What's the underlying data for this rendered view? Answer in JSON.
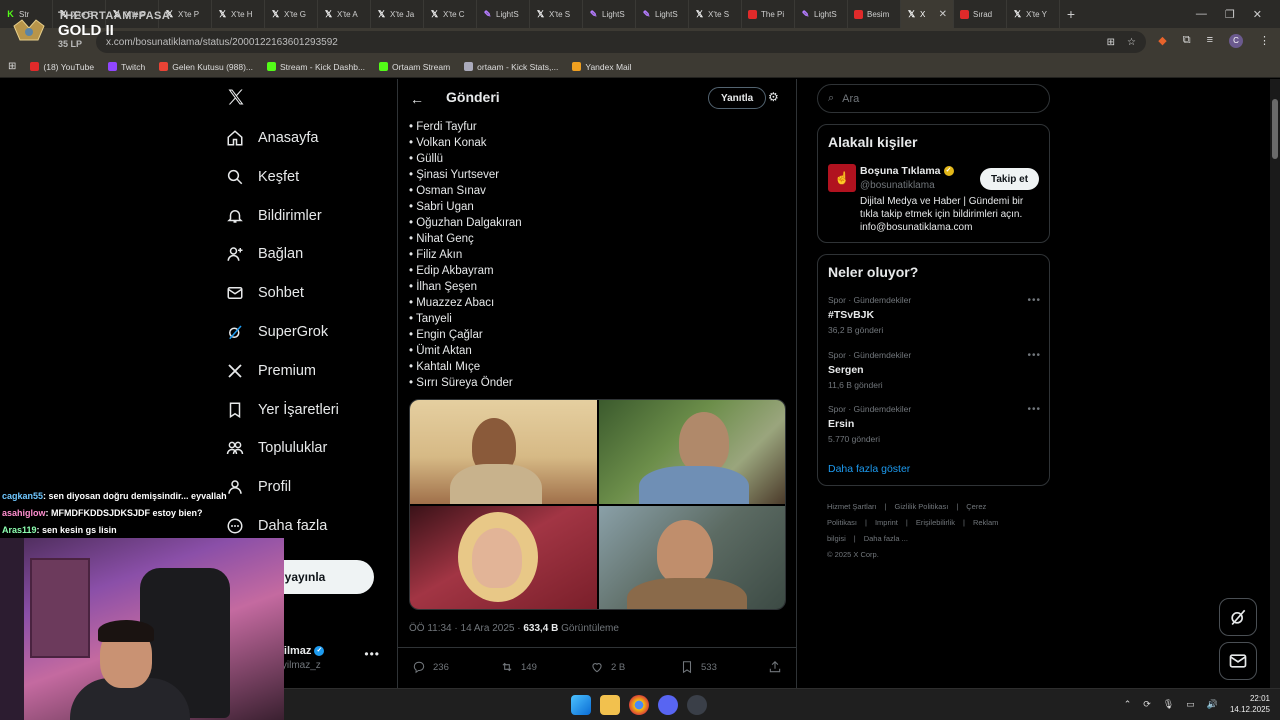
{
  "browser": {
    "tabs": [
      {
        "label": "Str",
        "icon": "kick-icon",
        "active": false
      },
      {
        "label": "X'te B",
        "icon": "x-icon",
        "active": false
      },
      {
        "label": "X'te P",
        "icon": "x-icon",
        "active": false
      },
      {
        "label": "X'te P",
        "icon": "x-icon",
        "active": false
      },
      {
        "label": "X'te H",
        "icon": "x-icon",
        "active": false
      },
      {
        "label": "X'te G",
        "icon": "x-icon",
        "active": false
      },
      {
        "label": "X'te A",
        "icon": "x-icon",
        "active": false
      },
      {
        "label": "X'te Ja",
        "icon": "x-icon",
        "active": false
      },
      {
        "label": "X'te C",
        "icon": "x-icon",
        "active": false
      },
      {
        "label": "LightS",
        "icon": "lightshot-icon",
        "active": false
      },
      {
        "label": "X'te S",
        "icon": "x-icon",
        "active": false
      },
      {
        "label": "LightS",
        "icon": "lightshot-icon",
        "active": false
      },
      {
        "label": "LightS",
        "icon": "lightshot-icon",
        "active": false
      },
      {
        "label": "X'te S",
        "icon": "x-icon",
        "active": false
      },
      {
        "label": "The Pi",
        "icon": "youtube-icon",
        "active": false
      },
      {
        "label": "LightS",
        "icon": "lightshot-icon",
        "active": false
      },
      {
        "label": "Besim",
        "icon": "youtube-icon",
        "active": false
      },
      {
        "label": "X",
        "icon": "x-icon",
        "active": true
      },
      {
        "label": "Sırad",
        "icon": "youtube-icon",
        "active": false
      },
      {
        "label": "X'te Y",
        "icon": "x-icon",
        "active": false
      }
    ],
    "url": "x.com/bosunatiklama/status/2000122163601293592",
    "bookmarks": [
      {
        "label": "(18) YouTube",
        "icon": "youtube-icon"
      },
      {
        "label": "Twitch",
        "icon": "twitch-icon"
      },
      {
        "label": "Gelen Kutusu (988)...",
        "icon": "gmail-icon"
      },
      {
        "label": "Stream - Kick Dashb...",
        "icon": "kick-icon"
      },
      {
        "label": "Ortaam Stream",
        "icon": "kick-icon"
      },
      {
        "label": "ortaam - Kick Stats,...",
        "icon": "stats-icon"
      },
      {
        "label": "Yandex Mail",
        "icon": "mail-icon"
      }
    ]
  },
  "overlay": {
    "rank_name": "THEORTAAM#PASA",
    "rank_tier": "GOLD II",
    "rank_lp": "35 LP",
    "chat": [
      {
        "user": "cagkan55",
        "message": ": sen diyosan doğru demişsindir... eyvallah"
      },
      {
        "user": "asahiglow",
        "message": ": MFMDFKDDSJDKSJDF estoy bien?"
      },
      {
        "user": "Aras119",
        "message": ": sen kesin gs lisin"
      }
    ]
  },
  "nav": {
    "items": [
      {
        "label": "Anasayfa",
        "icon": "home-icon"
      },
      {
        "label": "Keşfet",
        "icon": "search-icon"
      },
      {
        "label": "Bildirimler",
        "icon": "bell-icon"
      },
      {
        "label": "Bağlan",
        "icon": "add-person-icon"
      },
      {
        "label": "Sohbet",
        "icon": "mail-icon"
      },
      {
        "label": "SuperGrok",
        "icon": "grok-icon"
      },
      {
        "label": "Premium",
        "icon": "x-icon"
      },
      {
        "label": "Yer İşaretleri",
        "icon": "bookmark-icon"
      },
      {
        "label": "Topluluklar",
        "icon": "people-icon"
      },
      {
        "label": "Profil",
        "icon": "person-icon"
      },
      {
        "label": "Daha fazla",
        "icon": "more-circle-icon"
      }
    ],
    "post_button": "eri yayınla",
    "account_name": "etyilmaz",
    "account_handle": "netyilmaz_z"
  },
  "post": {
    "header_title": "Gönderi",
    "reply_label": "Yanıtla",
    "names": [
      "• Ferdi Tayfur",
      "• Volkan Konak",
      "• Güllü",
      "• Şinasi Yurtsever",
      "• Osman Sınav",
      "• Sabri Ugan",
      "• Oğuzhan Dalgakıran",
      "• Nihat Genç",
      "• Filiz Akın",
      "• Edip Akbayram",
      "• İlhan Şeşen",
      "• Muazzez Abacı",
      "• Tanyeli",
      "• Engin Çağlar",
      "• Ümit Aktan",
      "• Kahtalı Mıçe",
      "• Sırrı Süreya Önder"
    ],
    "time": "ÖÖ 11:34 · 14 Ara 2025 · ",
    "views": "633,4 B",
    "views_label": " Görüntüleme",
    "replies": "236",
    "reposts": "149",
    "likes": "2 B",
    "bookmarks": "533"
  },
  "sidebar": {
    "search_placeholder": "Ara",
    "relevant_title": "Alakalı kişiler",
    "relevant_name": "Boşuna Tıklama",
    "relevant_handle": "@bosunatiklama",
    "follow_label": "Takip et",
    "relevant_bio": "Dijital Medya ve Haber | Gündemi bir tıkla takip etmek için bildirimleri açın. info@bosunatiklama.com",
    "trends_title": "Neler oluyor?",
    "trends": [
      {
        "category": "Spor · Gündemdekiler",
        "title": "#TSvBJK",
        "count": "36,2 B gönderi"
      },
      {
        "category": "Spor · Gündemdekiler",
        "title": "Sergen",
        "count": "11,6 B gönderi"
      },
      {
        "category": "Spor · Gündemdekiler",
        "title": "Ersin",
        "count": "5.770 gönderi"
      }
    ],
    "show_more": "Daha fazla göster",
    "footer": [
      "Hizmet Şartları",
      "|",
      "Gizlilik Politikası",
      "|",
      "Çerez Politikası",
      "|",
      "Imprint",
      "|",
      "Erişilebilirlik",
      "|",
      "Reklam bilgisi",
      "|",
      "Daha fazla ...",
      "© 2025 X Corp."
    ]
  },
  "taskbar": {
    "time": "22:01",
    "date": "14.12.2025"
  }
}
